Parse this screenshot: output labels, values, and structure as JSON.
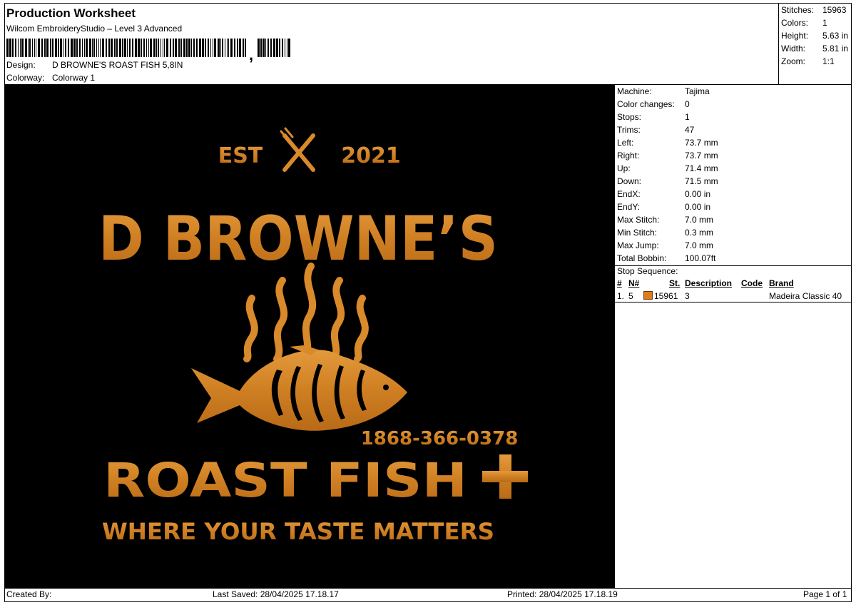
{
  "header": {
    "title": "Production Worksheet",
    "software": "Wilcom EmbroideryStudio – Level 3 Advanced",
    "barcode_tail": ",",
    "design_label": "Design:",
    "design_value": "D BROWNE'S ROAST FISH 5,8IN",
    "colorway_label": "Colorway:",
    "colorway_value": "Colorway 1"
  },
  "summary": {
    "stitches_label": "Stitches:",
    "stitches_value": "15963",
    "colors_label": "Colors:",
    "colors_value": "1",
    "height_label": "Height:",
    "height_value": "5.63 in",
    "width_label": "Width:",
    "width_value": "5.81 in",
    "zoom_label": "Zoom:",
    "zoom_value": "1:1"
  },
  "design_text": {
    "est": "EST",
    "year": "2021",
    "name": "D BROWNE’S",
    "phone": "1868-366-0378",
    "roast": "ROAST FISH",
    "tagline": "WHERE YOUR TASTE MATTERS"
  },
  "details": [
    {
      "label": "Machine:",
      "value": "Tajima"
    },
    {
      "label": "Color changes:",
      "value": "0"
    },
    {
      "label": "Stops:",
      "value": "1"
    },
    {
      "label": "Trims:",
      "value": "47"
    },
    {
      "label": "Left:",
      "value": "73.7 mm"
    },
    {
      "label": "Right:",
      "value": "73.7 mm"
    },
    {
      "label": "Up:",
      "value": "71.4 mm"
    },
    {
      "label": "Down:",
      "value": "71.5 mm"
    },
    {
      "label": "EndX:",
      "value": "0.00 in"
    },
    {
      "label": "EndY:",
      "value": "0.00 in"
    },
    {
      "label": "Max Stitch:",
      "value": "7.0 mm"
    },
    {
      "label": "Min Stitch:",
      "value": "0.3 mm"
    },
    {
      "label": "Max Jump:",
      "value": "7.0 mm"
    },
    {
      "label": "Total Bobbin:",
      "value": "100.07ft"
    }
  ],
  "stops": {
    "title": "Stop Sequence:",
    "headers": {
      "num": "#",
      "n": "N#",
      "st": "St.",
      "description": "Description",
      "code": "Code",
      "brand": "Brand"
    },
    "rows": [
      {
        "num": "1.",
        "n": "5",
        "st": "15961",
        "description": "3",
        "code": "",
        "brand": "Madeira Classic 40",
        "color": "#e07b1d"
      }
    ]
  },
  "colors": {
    "thread": "#d98a2b",
    "background": "#000000"
  },
  "footer": {
    "created_by": "Created By:",
    "last_saved": "Last Saved: 28/04/2025 17.18.17",
    "printed": "Printed: 28/04/2025 17.18.19",
    "page": "Page 1 of 1"
  }
}
